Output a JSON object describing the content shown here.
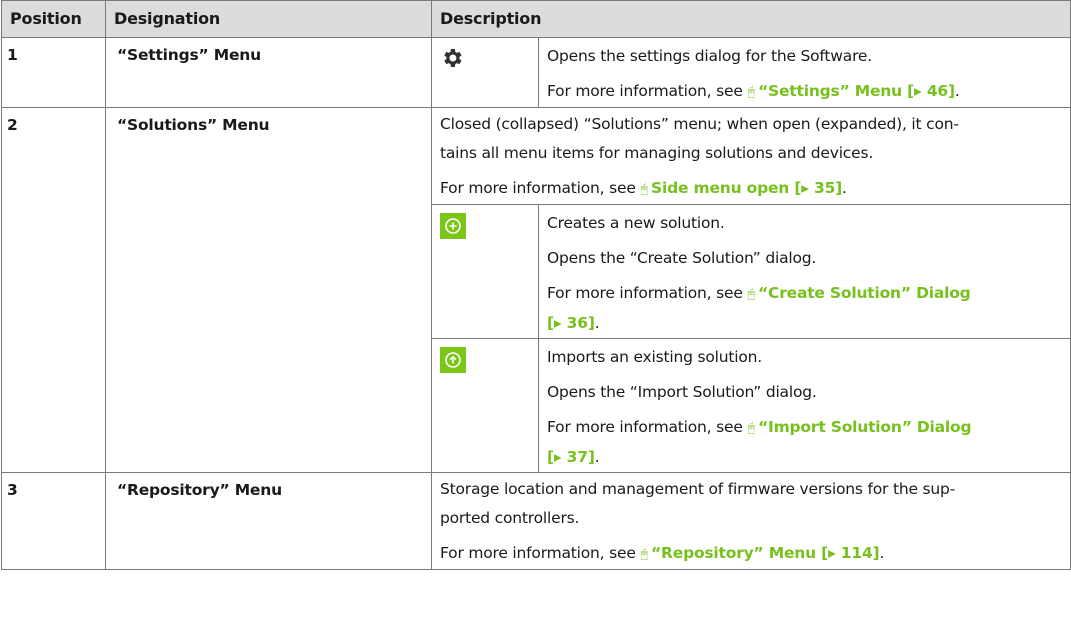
{
  "headers": {
    "position": "Position",
    "designation": "Designation",
    "description": "Description"
  },
  "more_info_prefix": "For more information, see",
  "rows": {
    "settings": {
      "position": "1",
      "designation": "“Settings” Menu",
      "icon": "gear-icon",
      "text": "Opens the settings dialog for the Software.",
      "link_text": "“Settings” Menu [▸ 46]"
    },
    "solutions": {
      "position": "2",
      "designation": "“Solutions” Menu",
      "text_line1": "Closed (collapsed) “Solutions” menu; when open (expanded), it con-",
      "text_line2": "tains all menu items for managing solutions and devices.",
      "link_text": "Side menu open [▸ 35]",
      "create": {
        "icon": "plus-circle-icon",
        "text1": "Creates a new solution.",
        "text2": "Opens the “Create Solution” dialog.",
        "link_line1": "“Create Solution” Dialog",
        "link_line2": "[▸ 36]"
      },
      "import": {
        "icon": "upload-circle-icon",
        "text1": "Imports an existing solution.",
        "text2": "Opens the “Import Solution” dialog.",
        "link_line1": "“Import Solution” Dialog",
        "link_line2": "[▸ 37]"
      }
    },
    "repository": {
      "position": "3",
      "designation": "“Repository” Menu",
      "text_line1": "Storage location and management of firmware versions for the sup-",
      "text_line2": "ported controllers.",
      "link_text": "“Repository” Menu [▸ 114]"
    }
  },
  "colors": {
    "link": "#78c01e",
    "button": "#7cc61a",
    "header_bg": "#dcdcdc"
  }
}
